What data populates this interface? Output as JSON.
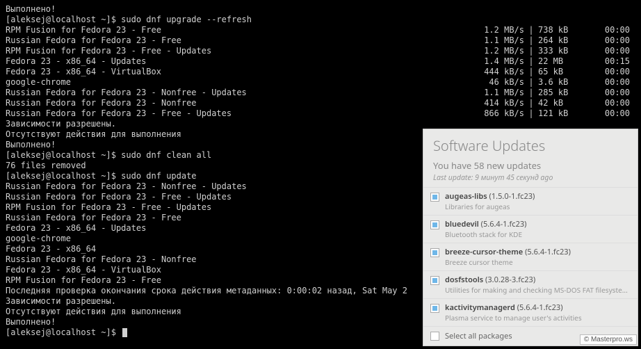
{
  "terminal": {
    "done1": "Выполнено!",
    "prompt": "[aleksej@localhost ~]$ ",
    "cmd_upgrade": "sudo dnf upgrade --refresh",
    "repos1": [
      {
        "name": "RPM Fusion for Fedora 23 - Free",
        "speed": "1.2 MB/s",
        "size": "738 kB",
        "time": "00:00"
      },
      {
        "name": "Russian Fedora for Fedora 23 - Free",
        "speed": "1.1 MB/s",
        "size": "264 kB",
        "time": "00:00"
      },
      {
        "name": "RPM Fusion for Fedora 23 - Free - Updates",
        "speed": "1.2 MB/s",
        "size": "333 kB",
        "time": "00:00"
      },
      {
        "name": "Fedora 23 - x86_64 - Updates",
        "speed": "1.4 MB/s",
        "size": "22 MB",
        "time": "00:15"
      },
      {
        "name": "Fedora 23 - x86_64 - VirtualBox",
        "speed": "444 kB/s",
        "size": "65 kB",
        "time": "00:00"
      },
      {
        "name": "google-chrome",
        "speed": "46 kB/s",
        "size": "3.6 kB",
        "time": "00:00"
      },
      {
        "name": "Russian Fedora for Fedora 23 - Nonfree - Updates",
        "speed": "1.1 MB/s",
        "size": "285 kB",
        "time": "00:00"
      },
      {
        "name": "Russian Fedora for Fedora 23 - Nonfree",
        "speed": "414 kB/s",
        "size": "42 kB",
        "time": "00:00"
      },
      {
        "name": "Russian Fedora for Fedora 23 - Free - Updates",
        "speed": "866 kB/s",
        "size": "121 kB",
        "time": "00:00"
      }
    ],
    "deps_resolved": "Зависимости разрешены.",
    "no_actions": "Отсутствуют действия для выполнения",
    "done2": "Выполнено!",
    "cmd_clean": "sudo dnf clean all",
    "files_removed": "76 files removed",
    "cmd_update": "sudo dnf update",
    "repos2": [
      "Russian Fedora for Fedora 23 - Nonfree - Updates",
      "Russian Fedora for Fedora 23 - Free - Updates",
      "RPM Fusion for Fedora 23 - Free - Updates",
      "Russian Fedora for Fedora 23 - Free",
      "Fedora 23 - x86_64 - Updates",
      "google-chrome",
      "Fedora 23 - x86_64",
      "Russian Fedora for Fedora 23 - Nonfree",
      "Fedora 23 - x86_64 - VirtualBox",
      "RPM Fusion for Fedora 23 - Free"
    ],
    "meta_check": "Последняя проверка окончания срока действия метаданных: 0:00:02 назад, Sat May 2"
  },
  "popup": {
    "title": "Software Updates",
    "subtitle": "You have 58 new updates",
    "last_update": "Last update: 9 минут 45 секунд ago",
    "updates": [
      {
        "name": "augeas-libs",
        "ver": "(1.5.0-1.fc23)",
        "desc": "Libraries for augeas"
      },
      {
        "name": "bluedevil",
        "ver": "(5.6.4-1.fc23)",
        "desc": "Bluetooth stack for KDE"
      },
      {
        "name": "breeze-cursor-theme",
        "ver": "(5.6.4-1.fc23)",
        "desc": "Breeze cursor theme"
      },
      {
        "name": "dosfstools",
        "ver": "(3.0.28-3.fc23)",
        "desc": "Utilities for making and checking MS-DOS FAT filesyste..."
      },
      {
        "name": "kactivitymanagerd",
        "ver": "(5.6.4-1.fc23)",
        "desc": "Plasma service to manage user's activities"
      }
    ],
    "select_all": "Select all packages"
  },
  "watermark": "© Masterpro.ws"
}
